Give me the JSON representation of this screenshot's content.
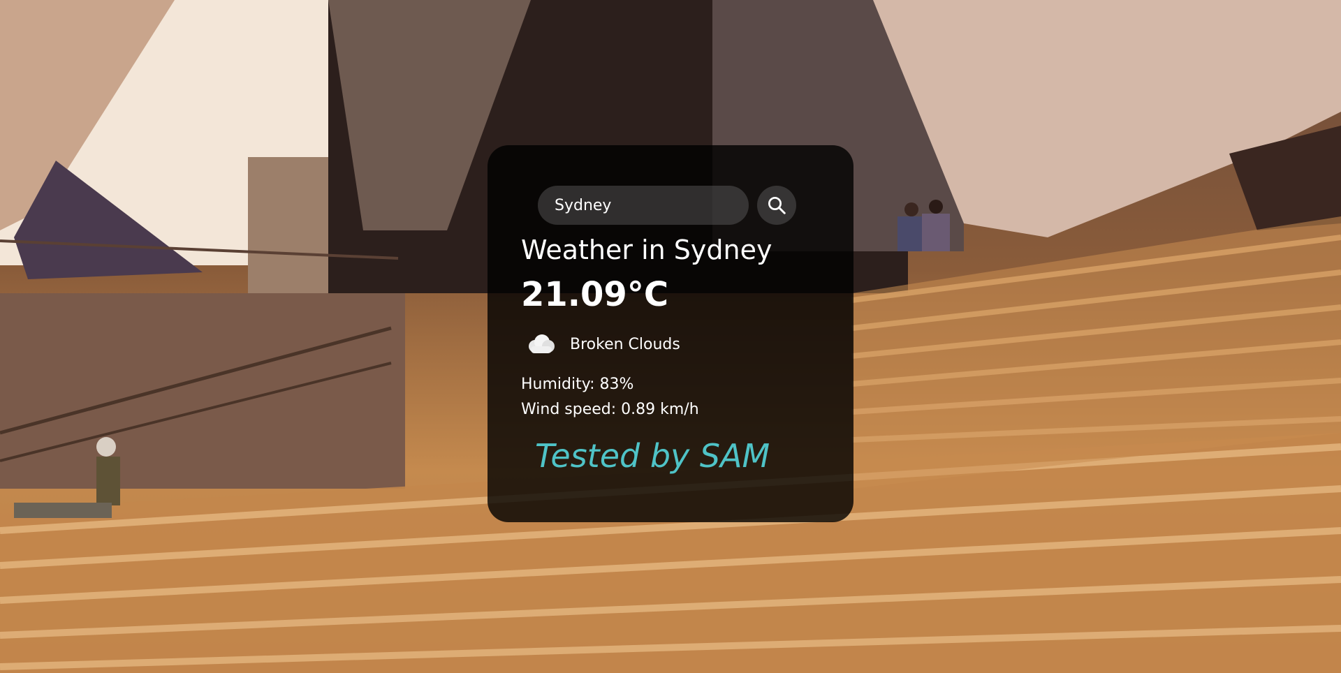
{
  "search": {
    "value": "Sydney",
    "button_icon": "search-icon"
  },
  "weather": {
    "title": "Weather in Sydney",
    "temperature": "21.09°C",
    "icon": "cloud-icon",
    "description": "Broken Clouds",
    "humidity": "Humidity: 83%",
    "wind": "Wind speed: 0.89 km/h"
  },
  "footer": {
    "tested_label": "Tested by SAM"
  },
  "colors": {
    "card_background": "#000000",
    "text": "#ffffff",
    "accent": "#4fc3c7"
  },
  "background": {
    "description_icon": "opera-house-steps-photo"
  }
}
